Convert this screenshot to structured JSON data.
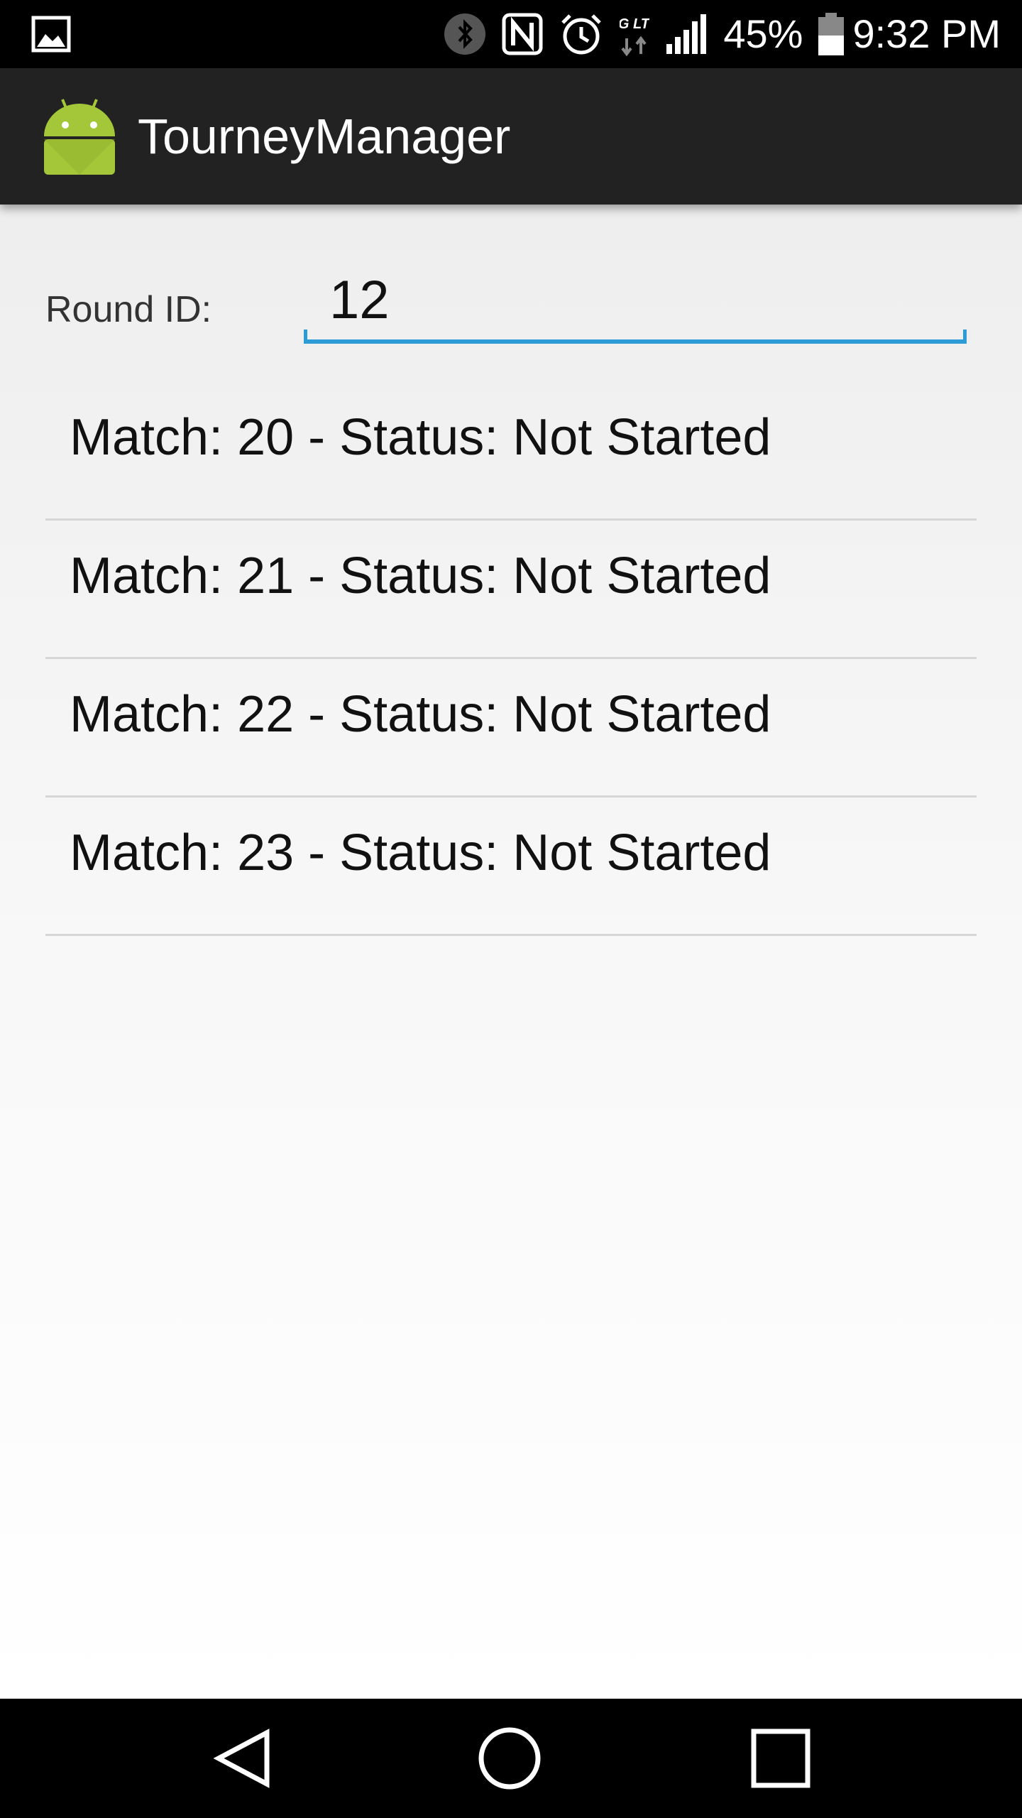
{
  "status_bar": {
    "left_icon": "image-icon",
    "icons": [
      "bluetooth-icon",
      "nfc-icon",
      "alarm-icon",
      "4g-lte-icon",
      "signal-icon",
      "battery-icon"
    ],
    "network_label": "4G LTE",
    "battery_percent": "45%",
    "time": "9:32 PM"
  },
  "app_bar": {
    "title": "TourneyManager",
    "logo_icon": "android-icon",
    "logo_color": "#a4c639"
  },
  "form": {
    "round_label": "Round ID:",
    "round_value": "12",
    "accent_color": "#2c9bd6"
  },
  "matches": [
    {
      "label": "Match: 20 - Status: Not Started"
    },
    {
      "label": "Match: 21 - Status: Not Started"
    },
    {
      "label": "Match: 22 - Status: Not Started"
    },
    {
      "label": "Match: 23 - Status: Not Started"
    }
  ],
  "nav_bar": {
    "buttons": [
      "back-icon",
      "home-icon",
      "recent-apps-icon"
    ]
  }
}
